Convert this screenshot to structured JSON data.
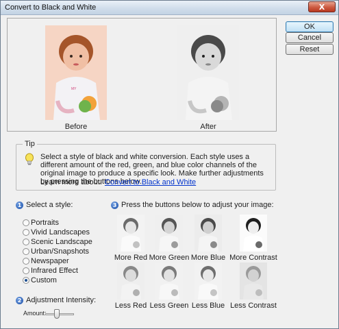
{
  "window": {
    "title": "Convert to Black and White",
    "close_glyph": "X"
  },
  "preview": {
    "before_caption": "Before",
    "after_caption": "After"
  },
  "buttons": {
    "ok": "OK",
    "cancel": "Cancel",
    "reset": "Reset"
  },
  "tip": {
    "label": "Tip",
    "text": "Select a style of black and white conversion. Each style uses a different amount of the red, green, and blue color channels of the original image to produce a specific look. Make further adjustments by pressing the buttons below.",
    "learn_prefix": "Learn more about:",
    "learn_link": "Convert to Black and White"
  },
  "style_section": {
    "number": "1",
    "label": "Select a style:",
    "options": [
      "Portraits",
      "Vivid Landscapes",
      "Scenic Landscape",
      "Urban/Snapshots",
      "Newspaper",
      "Infrared Effect",
      "Custom"
    ],
    "selected": "Custom"
  },
  "intensity_section": {
    "number": "2",
    "label": "Adjustment Intensity:",
    "amount_label": "Amount:",
    "amount_value": 0.5
  },
  "adjust_section": {
    "number": "3",
    "label": "Press the buttons below to adjust your image:",
    "buttons": [
      "More Red",
      "More Green",
      "More Blue",
      "More Contrast",
      "Less Red",
      "Less Green",
      "Less Blue",
      "Less Contrast"
    ]
  },
  "icons": {
    "tip": "lightbulb-icon"
  },
  "colors": {
    "link": "#0033cc",
    "step_badge": "#1b4fa8"
  }
}
